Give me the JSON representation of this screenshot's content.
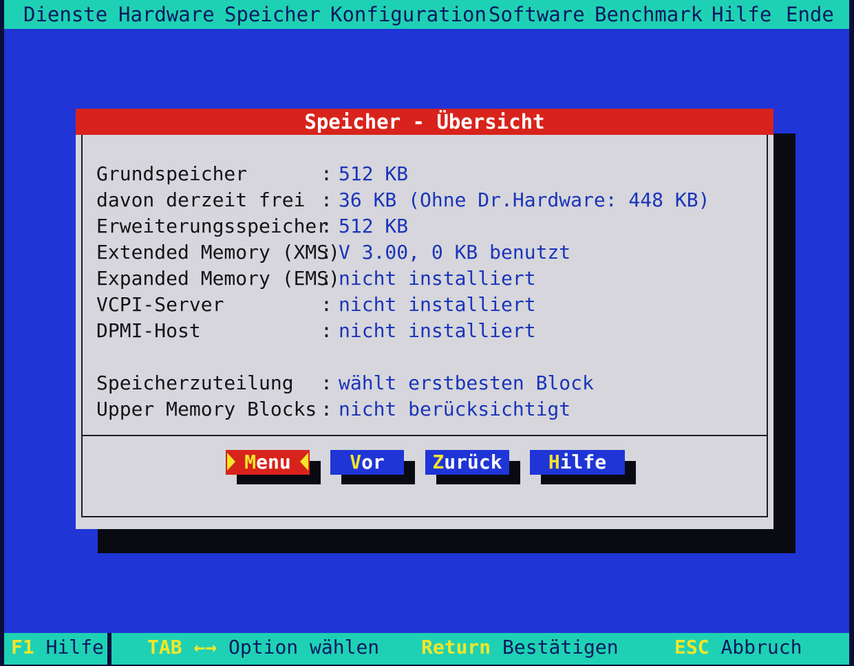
{
  "menu": {
    "items": [
      "Dienste",
      "Hardware",
      "Speicher",
      "Konfiguration",
      "Software",
      "Benchmark",
      "Hilfe",
      "Ende"
    ]
  },
  "dialog": {
    "title": "Speicher - Übersicht",
    "rows": [
      {
        "label": "Grundspeicher",
        "sep": ":",
        "value": "512 KB"
      },
      {
        "label": "davon derzeit frei",
        "sep": ":",
        "value": "36 KB (Ohne Dr.Hardware: 448 KB)"
      },
      {
        "label": "Erweiterungsspeicher",
        "sep": ":",
        "value": "512 KB"
      },
      {
        "label": "Extended Memory (XMS)",
        "sep": ":",
        "value": "V 3.00, 0 KB benutzt"
      },
      {
        "label": "Expanded Memory (EMS)",
        "sep": ":",
        "value": "nicht installiert"
      },
      {
        "label": "VCPI-Server",
        "sep": ":",
        "value": "nicht installiert"
      },
      {
        "label": "DPMI-Host",
        "sep": ":",
        "value": "nicht installiert"
      },
      {
        "label": "Speicherzuteilung",
        "sep": ":",
        "value": "wählt erstbesten Block"
      },
      {
        "label": "Upper Memory Blocks",
        "sep": ":",
        "value": "nicht berücksichtigt"
      }
    ],
    "buttons": {
      "menu": {
        "first": "M",
        "rest": "enu"
      },
      "vor": {
        "first": "V",
        "rest": "or"
      },
      "zurueck": {
        "first": "Z",
        "rest": "urück"
      },
      "hilfe": {
        "first": "H",
        "rest": "ilfe"
      }
    }
  },
  "status": {
    "f1_key": "F1",
    "f1_text": "Hilfe",
    "tab_key": "TAB",
    "tab_arrows": "←→",
    "tab_text": "Option wählen",
    "return_key": "Return",
    "return_text": "Bestätigen",
    "esc_key": "ESC",
    "esc_text": "Abbruch"
  },
  "colors": {
    "background": "#1f35d6",
    "bar": "#1fd1b4",
    "title": "#d8231c",
    "value_text": "#1b34b9",
    "hotkey": "#f2e62a"
  }
}
